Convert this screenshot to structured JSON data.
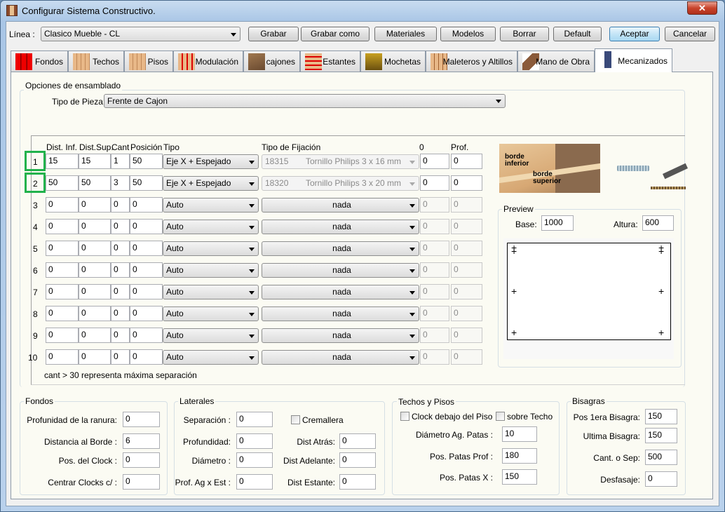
{
  "window": {
    "title": "Configurar Sistema Constructivo.",
    "close": "✕"
  },
  "toolbar": {
    "linea_label": "Línea :",
    "linea_value": "Clasico Mueble - CL",
    "buttons": [
      "Grabar",
      "Grabar como",
      "Materiales",
      "Modelos",
      "Borrar",
      "Default",
      "Aceptar",
      "Cancelar"
    ]
  },
  "tabs": [
    "Fondos",
    "Techos",
    "Pisos",
    "Modulación",
    "cajones",
    "Estantes",
    "Mochetas",
    "Maleteros y Altillos",
    "Mano de Obra",
    "Mecanizados"
  ],
  "active_tab": "Mecanizados",
  "opciones": {
    "title": "Opciones de ensamblado",
    "tipo_pieza_label": "Tipo de Pieza:",
    "tipo_pieza_value": "Frente de Cajon"
  },
  "grid": {
    "headers": [
      "Dist. Inf.",
      "Dist.Sup.",
      "Cant",
      "Posición",
      "Tipo",
      "Tipo de Fijación",
      "0",
      "Prof."
    ],
    "rows": [
      {
        "n": "1",
        "inf": "15",
        "sup": "15",
        "cant": "1",
        "pos": "50",
        "tipo": "Eje X + Espejado",
        "fij_code": "18315",
        "fij": "Tornillo Philips 3 x 16 mm",
        "c0": "0",
        "prof": "0",
        "highlight": true
      },
      {
        "n": "2",
        "inf": "50",
        "sup": "50",
        "cant": "3",
        "pos": "50",
        "tipo": "Eje X + Espejado",
        "fij_code": "18320",
        "fij": "Tornillo Philips 3 x 20 mm",
        "c0": "0",
        "prof": "0",
        "highlight": true
      },
      {
        "n": "3",
        "inf": "0",
        "sup": "0",
        "cant": "0",
        "pos": "0",
        "tipo": "Auto",
        "fij_code": "",
        "fij": "nada",
        "c0": "0",
        "prof": "0"
      },
      {
        "n": "4",
        "inf": "0",
        "sup": "0",
        "cant": "0",
        "pos": "0",
        "tipo": "Auto",
        "fij_code": "",
        "fij": "nada",
        "c0": "0",
        "prof": "0"
      },
      {
        "n": "5",
        "inf": "0",
        "sup": "0",
        "cant": "0",
        "pos": "0",
        "tipo": "Auto",
        "fij_code": "",
        "fij": "nada",
        "c0": "0",
        "prof": "0"
      },
      {
        "n": "6",
        "inf": "0",
        "sup": "0",
        "cant": "0",
        "pos": "0",
        "tipo": "Auto",
        "fij_code": "",
        "fij": "nada",
        "c0": "0",
        "prof": "0"
      },
      {
        "n": "7",
        "inf": "0",
        "sup": "0",
        "cant": "0",
        "pos": "0",
        "tipo": "Auto",
        "fij_code": "",
        "fij": "nada",
        "c0": "0",
        "prof": "0"
      },
      {
        "n": "8",
        "inf": "0",
        "sup": "0",
        "cant": "0",
        "pos": "0",
        "tipo": "Auto",
        "fij_code": "",
        "fij": "nada",
        "c0": "0",
        "prof": "0"
      },
      {
        "n": "9",
        "inf": "0",
        "sup": "0",
        "cant": "0",
        "pos": "0",
        "tipo": "Auto",
        "fij_code": "",
        "fij": "nada",
        "c0": "0",
        "prof": "0"
      },
      {
        "n": "10",
        "inf": "0",
        "sup": "0",
        "cant": "0",
        "pos": "0",
        "tipo": "Auto",
        "fij_code": "",
        "fij": "nada",
        "c0": "0",
        "prof": "0"
      }
    ],
    "note": "cant  > 30 representa máxima separación"
  },
  "diagram": {
    "label_inferior": "borde inferior",
    "label_superior": "borde superior"
  },
  "preview": {
    "title": "Preview",
    "base_label": "Base:",
    "base": "1000",
    "altura_label": "Altura:",
    "altura": "600"
  },
  "fondos": {
    "title": "Fondos",
    "fields": [
      {
        "label": "Profunidad de la ranura:",
        "value": "0"
      },
      {
        "label": "Distancia al Borde :",
        "value": "6"
      },
      {
        "label": "Pos. del Clock :",
        "value": "0"
      },
      {
        "label": "Centrar Clocks c/ :",
        "value": "0"
      }
    ]
  },
  "laterales": {
    "title": "Laterales",
    "left": [
      {
        "label": "Separación :",
        "value": "0"
      },
      {
        "label": "Profundidad:",
        "value": "0"
      },
      {
        "label": "Diámetro :",
        "value": "0"
      },
      {
        "label": "Prof. Ag x Est :",
        "value": "0"
      }
    ],
    "cremallera": "Cremallera",
    "right": [
      {
        "label": "Dist Atrás:",
        "value": "0"
      },
      {
        "label": "Dist Adelante:",
        "value": "0"
      },
      {
        "label": "Dist Estante:",
        "value": "0"
      }
    ]
  },
  "techos": {
    "title": "Techos y Pisos",
    "cb1": "Clock debajo del Piso",
    "cb2": "sobre Techo",
    "fields": [
      {
        "label": "Diámetro Ag. Patas :",
        "value": "10"
      },
      {
        "label": "Pos. Patas Prof :",
        "value": "180"
      },
      {
        "label": "Pos. Patas X :",
        "value": "150"
      }
    ]
  },
  "bisagras": {
    "title": "Bisagras",
    "fields": [
      {
        "label": "Pos 1era Bisagra:",
        "value": "150"
      },
      {
        "label": "Ultima Bisagra:",
        "value": "150"
      },
      {
        "label": "Cant. o Sep:",
        "value": "500"
      },
      {
        "label": "Desfasaje:",
        "value": "0"
      }
    ]
  },
  "colors": {
    "highlight": "#22b24c",
    "panel": "#fbfbf3"
  }
}
